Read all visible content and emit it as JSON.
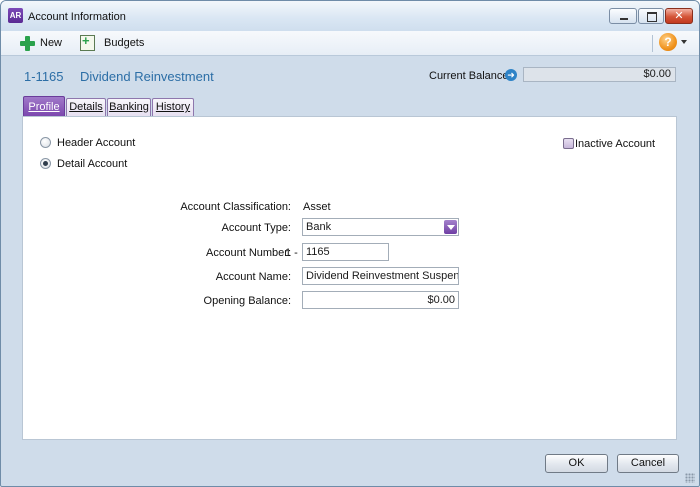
{
  "window": {
    "app_badge": "AR",
    "title": "Account Information"
  },
  "toolbar": {
    "new_label": "New",
    "budgets_label": "Budgets",
    "help_glyph": "?"
  },
  "header": {
    "account_number": "1-1165",
    "account_name": "Dividend Reinvestment",
    "current_balance_label": "Current Balance:",
    "current_balance_value": "$0.00"
  },
  "tabs": [
    {
      "label": "Profile",
      "active": true
    },
    {
      "label": "Details",
      "active": false
    },
    {
      "label": "Banking",
      "active": false
    },
    {
      "label": "History",
      "active": false
    }
  ],
  "profile": {
    "header_account_label": "Header Account",
    "detail_account_label": "Detail Account",
    "selected_type": "Detail Account",
    "inactive_label": "Inactive Account",
    "inactive_checked": false,
    "classification_label": "Account Classification:",
    "classification_value": "Asset",
    "type_label": "Account Type:",
    "type_value": "Bank",
    "number_label": "Account Number:",
    "number_prefix": "1 -",
    "number_value": "1165",
    "name_label": "Account Name:",
    "name_value": "Dividend Reinvestment Suspense",
    "opening_label": "Opening Balance:",
    "opening_value": "$0.00"
  },
  "footer": {
    "ok_label": "OK",
    "cancel_label": "Cancel"
  },
  "colors": {
    "accent_purple": "#7a44ad",
    "header_blue": "#2c6ea6",
    "add_green": "#2ba24c"
  }
}
